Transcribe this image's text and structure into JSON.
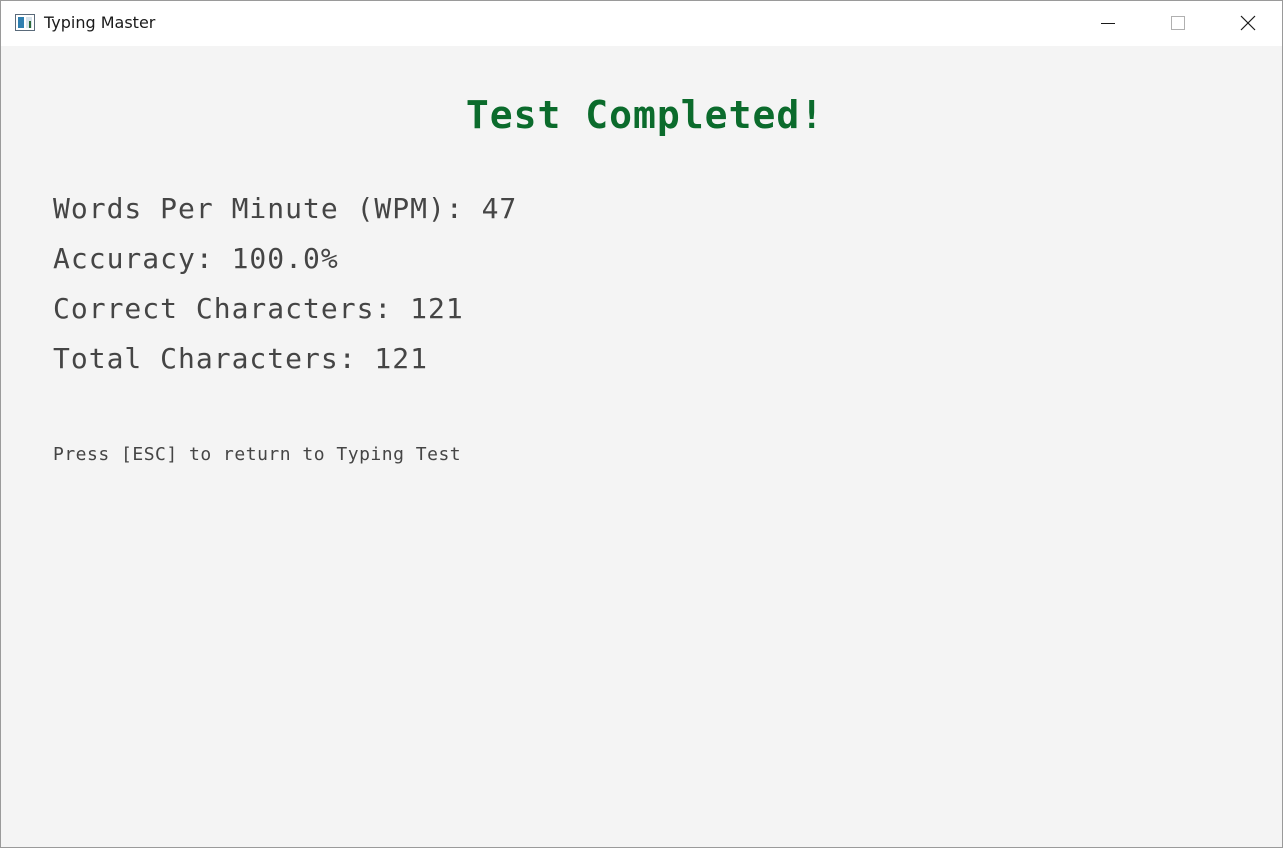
{
  "window": {
    "title": "Typing Master"
  },
  "controls": {
    "minimize_icon": "minimize-icon",
    "maximize_icon": "maximize-icon",
    "close_icon": "close-icon"
  },
  "results": {
    "heading": "Test Completed!",
    "heading_color": "#0b6b2c",
    "text_color": "#454545",
    "wpm": "Words Per Minute (WPM): 47",
    "accuracy": "Accuracy: 100.0%",
    "correct_characters": "Correct Characters: 121",
    "total_characters": "Total Characters: 121",
    "hint": "Press [ESC] to return to Typing Test"
  }
}
